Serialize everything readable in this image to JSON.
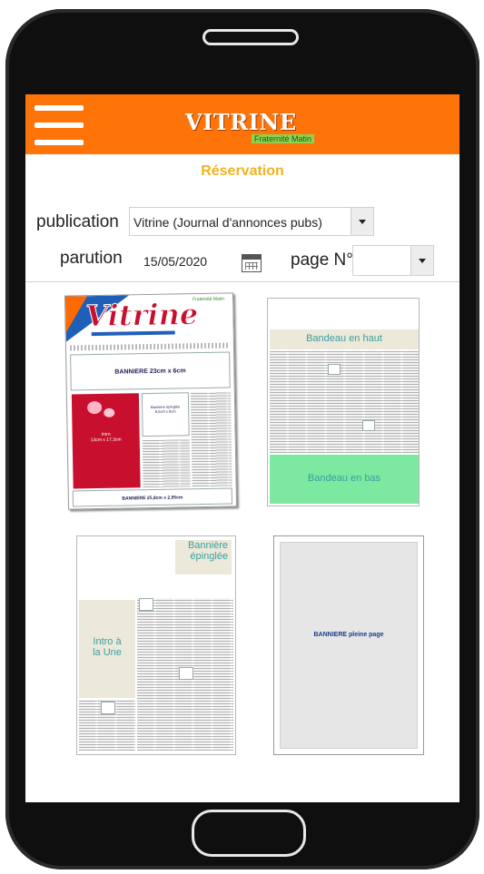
{
  "header": {
    "logo_text": "VITRINE",
    "logo_sub": "Fraternité Matin"
  },
  "page": {
    "title": "Réservation"
  },
  "form": {
    "publication_label": "publication",
    "publication_value": "Vitrine (Journal d'annonces pubs)",
    "parution_label": "parution",
    "parution_value": "15/05/2020",
    "page_label": "page N°",
    "page_value": ""
  },
  "options": [
    {
      "masthead": "Vitrine",
      "corner_logo": "Fraternité Matin",
      "top_banner": "BANNIERE 23cm x 6cm",
      "red_box": "Intro\n13cm x 17,3cm",
      "pinned_box": "Bannière épinglée\n6,5cm x 6cm",
      "bottom_banner": "BANNIERE 25,8cm x 2,95cm"
    },
    {
      "top": "Bandeau en haut",
      "bottom": "Bandeau en bas"
    },
    {
      "pinned": "Bannière\népinglée",
      "intro": "Intro à\nla Une"
    },
    {
      "full": "BANNIERE pleine page"
    }
  ],
  "colors": {
    "appbar": "#ff7409",
    "title": "#f0b41e",
    "green_band": "#7ce8a0",
    "red_ad": "#c8102e"
  }
}
